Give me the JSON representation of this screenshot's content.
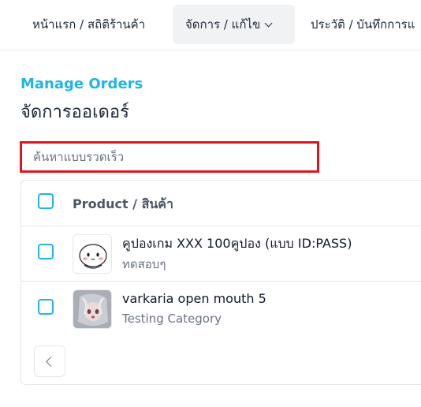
{
  "nav": {
    "items": [
      {
        "label": "หน้าแรก / สถิติร้านค้า"
      },
      {
        "label": "จัดการ / แก้ไข",
        "icon": "chevron-down-icon",
        "active": true
      },
      {
        "label": "ประวัติ / บันทึกการแ"
      }
    ]
  },
  "header": {
    "subtitle": "Manage Orders",
    "title": "จัดการออเดอร์"
  },
  "search": {
    "placeholder": "ค้นหาแบบรวดเร็ว",
    "value": "",
    "highlight_color": "#e0161c"
  },
  "table": {
    "column_header": "Product / สินค้า",
    "rows": [
      {
        "name": "คูปองเกม XXX 100คูปอง (แบบ ID:PASS)",
        "category": "ทดสอบๆ",
        "thumbnail": "cartoon-character-image"
      },
      {
        "name": "varkaria open mouth 5",
        "category": "Testing Category",
        "thumbnail": "anime-character-image"
      }
    ]
  },
  "pagination": {
    "prev_icon": "chevron-left-icon"
  },
  "colors": {
    "accent": "#22b4e6",
    "text": "#1f2937",
    "muted": "#6b7280"
  }
}
